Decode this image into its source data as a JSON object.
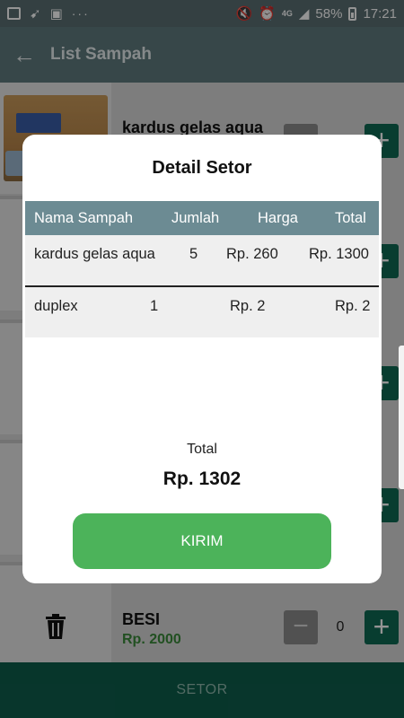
{
  "status_bar": {
    "battery": "58%",
    "time": "17:21",
    "network": "4G",
    "dots": "···"
  },
  "app_bar": {
    "title": "List Sampah"
  },
  "list": {
    "items": [
      {
        "name": "kardus gelas aqua",
        "price": "",
        "qty": ""
      },
      {
        "name": "",
        "price": "",
        "qty": ""
      },
      {
        "name": "",
        "price": "",
        "qty": ""
      },
      {
        "name": "",
        "price": "",
        "qty": ""
      },
      {
        "name": "BESI",
        "price": "Rp. 2000",
        "qty": "0"
      }
    ]
  },
  "bottom_bar": {
    "label": "SETOR"
  },
  "dialog": {
    "title": "Detail Setor",
    "columns": [
      "Nama Sampah",
      "Jumlah",
      "Harga",
      "Total"
    ],
    "rows": [
      {
        "nama": "kardus gelas aqua",
        "jumlah": "5",
        "harga": "Rp. 260",
        "total": "Rp. 1300"
      },
      {
        "nama": "duplex",
        "jumlah": "1",
        "harga": "Rp. 2",
        "total": "Rp. 2"
      }
    ],
    "total_label": "Total",
    "total_value": "Rp. 1302",
    "submit_label": "KIRIM"
  },
  "icons": {
    "back": "arrow-left-icon",
    "minus": "minus-icon",
    "plus": "plus-icon",
    "trash": "trash-icon"
  },
  "colors": {
    "primary_dark": "#0d5d4b",
    "plus_button": "#0e6a54",
    "submit_button": "#4cb35a",
    "table_header": "#6c8b93",
    "price_text": "#3a8a3a"
  }
}
